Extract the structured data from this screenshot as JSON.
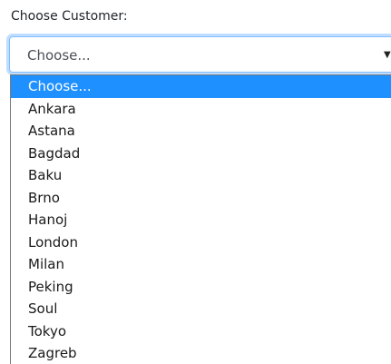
{
  "form": {
    "label": "Choose Customer:",
    "select_value": "Choose...",
    "arrow_icon": "caret-down-icon"
  },
  "dropdown": {
    "options": [
      "Choose...",
      "Ankara",
      "Astana",
      "Bagdad",
      "Baku",
      "Brno",
      "Hanoj",
      "London",
      "Milan",
      "Peking",
      "Soul",
      "Tokyo",
      "Zagreb"
    ],
    "highlighted_option": "Choose...",
    "highlight_color": "#1e90ff"
  }
}
